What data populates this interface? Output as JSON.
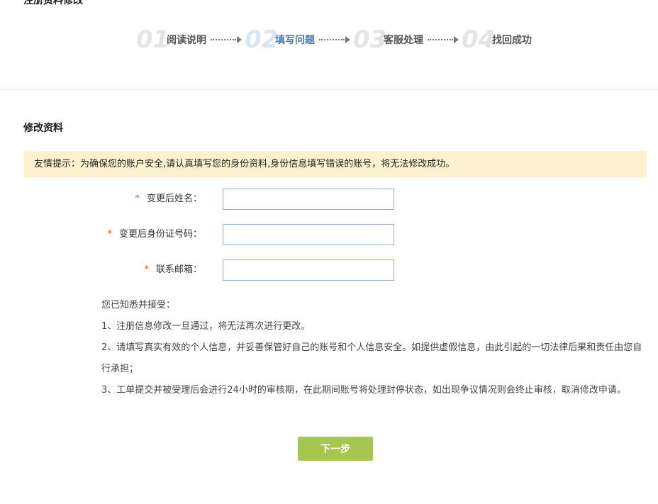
{
  "page": {
    "title": "注册资料修改"
  },
  "steps": [
    {
      "num": "01",
      "label": "阅读说明",
      "active": false
    },
    {
      "num": "02",
      "label": "填写问题",
      "active": true
    },
    {
      "num": "03",
      "label": "客服处理",
      "active": false
    },
    {
      "num": "04",
      "label": "找回成功",
      "active": false
    }
  ],
  "section": {
    "title": "修改资料"
  },
  "notice": {
    "text": "友情提示：为确保您的账户安全,请认真填写您的身份资料,身份信息填写错误的账号，将无法修改成功。"
  },
  "form": {
    "required_mark": "*",
    "fields": [
      {
        "label": "变更后姓名：",
        "value": ""
      },
      {
        "label": "变更后身份证号码：",
        "value": ""
      },
      {
        "label": "联系邮箱：",
        "value": ""
      }
    ]
  },
  "agreement": {
    "intro": "您已知悉并接受：",
    "items": [
      "1、注册信息修改一旦通过，将无法再次进行更改。",
      "2、请填写真实有效的个人信息，并妥善保管好自己的账号和个人信息安全。如提供虚假信息，由此引起的一切法律后果和责任由您自行承担；",
      "3、工单提交并被受理后会进行24小时的审核期，在此期间账号将处理封停状态，如出现争议情况则会终止审核，取消修改申请。"
    ]
  },
  "buttons": {
    "next": "下一步"
  },
  "colors": {
    "active_step": "#4a78b5",
    "notice_bg": "#fdf0cf",
    "required": "#e05a2a",
    "next_button": "#a6c74f"
  }
}
